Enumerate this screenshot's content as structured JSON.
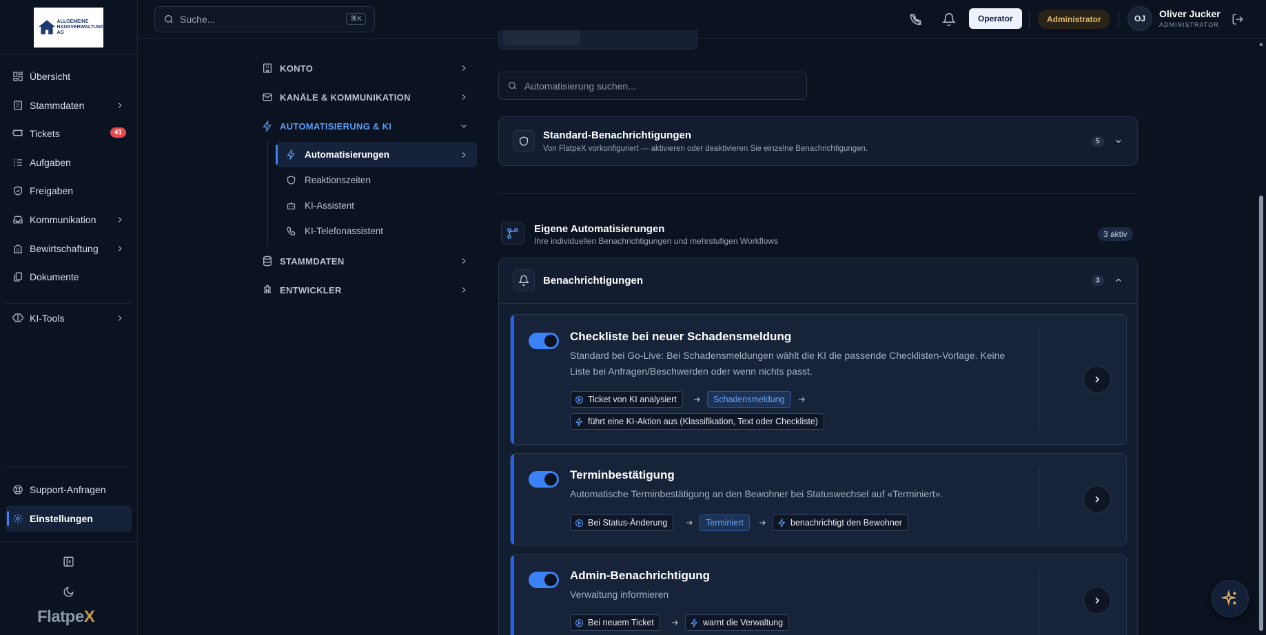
{
  "logo": {
    "text": "ALLGEMEINE HAUSVERWALTUNG AG"
  },
  "sidebar": {
    "items": [
      {
        "label": "Übersicht",
        "icon": "dashboard-icon"
      },
      {
        "label": "Stammdaten",
        "icon": "building-icon",
        "has_children": true
      },
      {
        "label": "Tickets",
        "icon": "ticket-icon",
        "badge": "41"
      },
      {
        "label": "Aufgaben",
        "icon": "list-icon"
      },
      {
        "label": "Freigaben",
        "icon": "shield-check-icon"
      },
      {
        "label": "Kommunikation",
        "icon": "inbox-icon",
        "has_children": true
      },
      {
        "label": "Bewirtschaftung",
        "icon": "building-icon",
        "has_children": true
      },
      {
        "label": "Dokumente",
        "icon": "documents-icon"
      },
      {
        "label": "KI-Tools",
        "icon": "brain-icon",
        "has_children": true
      }
    ],
    "bottom": [
      {
        "label": "Support-Anfragen",
        "icon": "lifebuoy-icon"
      },
      {
        "label": "Einstellungen",
        "icon": "gear-icon",
        "active": true
      }
    ],
    "brand": "Flatpe",
    "brand_x": "X"
  },
  "topbar": {
    "search_placeholder": "Suche...",
    "shortcut": "⌘K",
    "role_operator": "Operator",
    "role_admin": "Administrator",
    "avatar_initials": "OJ",
    "user_name": "Oliver Jucker",
    "user_role": "ADMINISTRATOR"
  },
  "settings_nav": {
    "sections": [
      {
        "label": "KONTO",
        "icon": "building-icon"
      },
      {
        "label": "KANÄLE & KOMMUNIKATION",
        "icon": "mail-icon"
      },
      {
        "label": "AUTOMATISIERUNG & KI",
        "icon": "bolt-icon",
        "open": true
      },
      {
        "label": "STAMMDATEN",
        "icon": "database-icon"
      },
      {
        "label": "ENTWICKLER",
        "icon": "puzzle-icon"
      }
    ],
    "children": [
      {
        "label": "Automatisierungen",
        "icon": "bolt-icon",
        "active": true
      },
      {
        "label": "Reaktionszeiten",
        "icon": "shield-icon"
      },
      {
        "label": "KI-Assistent",
        "icon": "robot-icon"
      },
      {
        "label": "KI-Telefonassistent",
        "icon": "phone-icon"
      }
    ]
  },
  "main": {
    "search_placeholder": "Automatisierung suchen...",
    "standard": {
      "title": "Standard-Benachrichtigungen",
      "subtitle": "Von FlatpeX vorkonfiguriert — aktivieren oder deaktivieren Sie einzelne Benachrichtigungen.",
      "count": "5"
    },
    "own": {
      "title": "Eigene Automatisierungen",
      "subtitle": "Ihre individuellen Benachrichtigungen und mehrstufigen Workflows",
      "active_label": "3 aktiv"
    },
    "notifications": {
      "title": "Benachrichtigungen",
      "count": "3"
    },
    "rules": [
      {
        "title": "Checkliste bei neuer Schadensmeldung",
        "description": "Standard bei Go-Live: Bei Schadensmeldungen wählt die KI die passende Checklisten-Vorlage. Keine Liste bei Anfragen/Beschwerden oder wenn nichts passt.",
        "enabled": true,
        "trigger": "Ticket von KI analysiert",
        "condition": "Schadensmeldung",
        "action": "führt eine KI-Aktion aus (Klassifikation, Text oder Checkliste)"
      },
      {
        "title": "Terminbestätigung",
        "description": "Automatische Terminbestätigung an den Bewohner bei Statuswechsel auf «Terminiert».",
        "enabled": true,
        "trigger": "Bei Status-Änderung",
        "condition": "Terminiert",
        "action": "benachrichtigt den Bewohner"
      },
      {
        "title": "Admin-Benachrichtigung",
        "description": "Verwaltung informieren",
        "enabled": true,
        "trigger": "Bei neuem Ticket",
        "action": "warnt die Verwaltung"
      }
    ]
  },
  "colors": {
    "accent": "#3b82f6",
    "admin": "#e2b56a",
    "badge": "#e5484d",
    "background": "#0b1220"
  }
}
